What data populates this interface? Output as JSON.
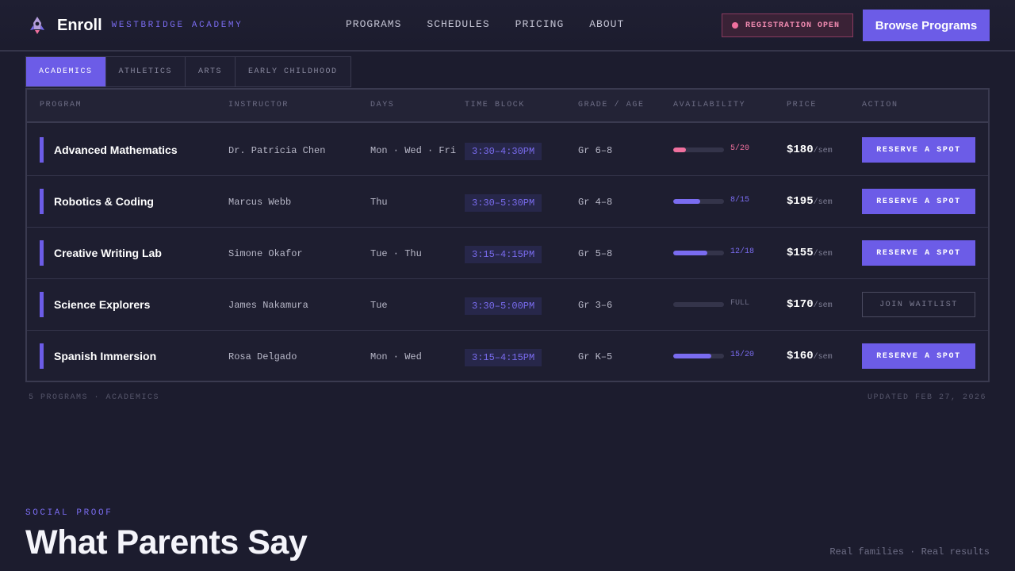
{
  "brand": {
    "name": "Enroll",
    "subtitle": "WESTBRIDGE ACADEMY"
  },
  "nav": [
    "PROGRAMS",
    "SCHEDULES",
    "PRICING",
    "ABOUT"
  ],
  "registration_badge": "REGISTRATION OPEN",
  "browse_button": "Browse Programs",
  "tabs": [
    {
      "label": "ACADEMICS",
      "active": true
    },
    {
      "label": "ATHLETICS",
      "active": false
    },
    {
      "label": "ARTS",
      "active": false
    },
    {
      "label": "EARLY CHILDHOOD",
      "active": false
    }
  ],
  "columns": [
    "PROGRAM",
    "INSTRUCTOR",
    "DAYS",
    "TIME BLOCK",
    "GRADE / AGE",
    "AVAILABILITY",
    "PRICE",
    "ACTION"
  ],
  "rows": [
    {
      "program": "Advanced Mathematics",
      "instructor": "Dr. Patricia Chen",
      "days": "Mon · Wed · Fri",
      "time": "3:30–4:30PM",
      "grade": "Gr 6–8",
      "availability": "5/20",
      "fill": 0.25,
      "status_color": "#f0709e",
      "price": "$180",
      "unit": "/sem",
      "action": "RESERVE A SPOT",
      "waitlist": false
    },
    {
      "program": "Robotics & Coding",
      "instructor": "Marcus Webb",
      "days": "Thu",
      "time": "3:30–5:30PM",
      "grade": "Gr 4–8",
      "availability": "8/15",
      "fill": 0.533,
      "status_color": "#7a6cf0",
      "price": "$195",
      "unit": "/sem",
      "action": "RESERVE A SPOT",
      "waitlist": false
    },
    {
      "program": "Creative Writing Lab",
      "instructor": "Simone Okafor",
      "days": "Tue · Thu",
      "time": "3:15–4:15PM",
      "grade": "Gr 5–8",
      "availability": "12/18",
      "fill": 0.667,
      "status_color": "#7a6cf0",
      "price": "$155",
      "unit": "/sem",
      "action": "RESERVE A SPOT",
      "waitlist": false
    },
    {
      "program": "Science Explorers",
      "instructor": "James Nakamura",
      "days": "Tue",
      "time": "3:30–5:00PM",
      "grade": "Gr 3–6",
      "availability": "FULL",
      "fill": 0,
      "status_color": "#6e6e86",
      "price": "$170",
      "unit": "/sem",
      "action": "JOIN WAITLIST",
      "waitlist": true
    },
    {
      "program": "Spanish Immersion",
      "instructor": "Rosa Delgado",
      "days": "Mon · Wed",
      "time": "3:15–4:15PM",
      "grade": "Gr K–5",
      "availability": "15/20",
      "fill": 0.75,
      "status_color": "#7a6cf0",
      "price": "$160",
      "unit": "/sem",
      "action": "RESERVE A SPOT",
      "waitlist": false
    }
  ],
  "footer": {
    "left": "5 PROGRAMS · ACADEMICS",
    "right": "UPDATED FEB 27, 2026"
  },
  "social_proof": {
    "eyebrow": "SOCIAL PROOF",
    "title": "What Parents Say",
    "side": "Real families · Real results"
  },
  "colors": {
    "accent": "#6c5ce7",
    "background": "#1c1c2e",
    "alert": "#f0709e"
  }
}
